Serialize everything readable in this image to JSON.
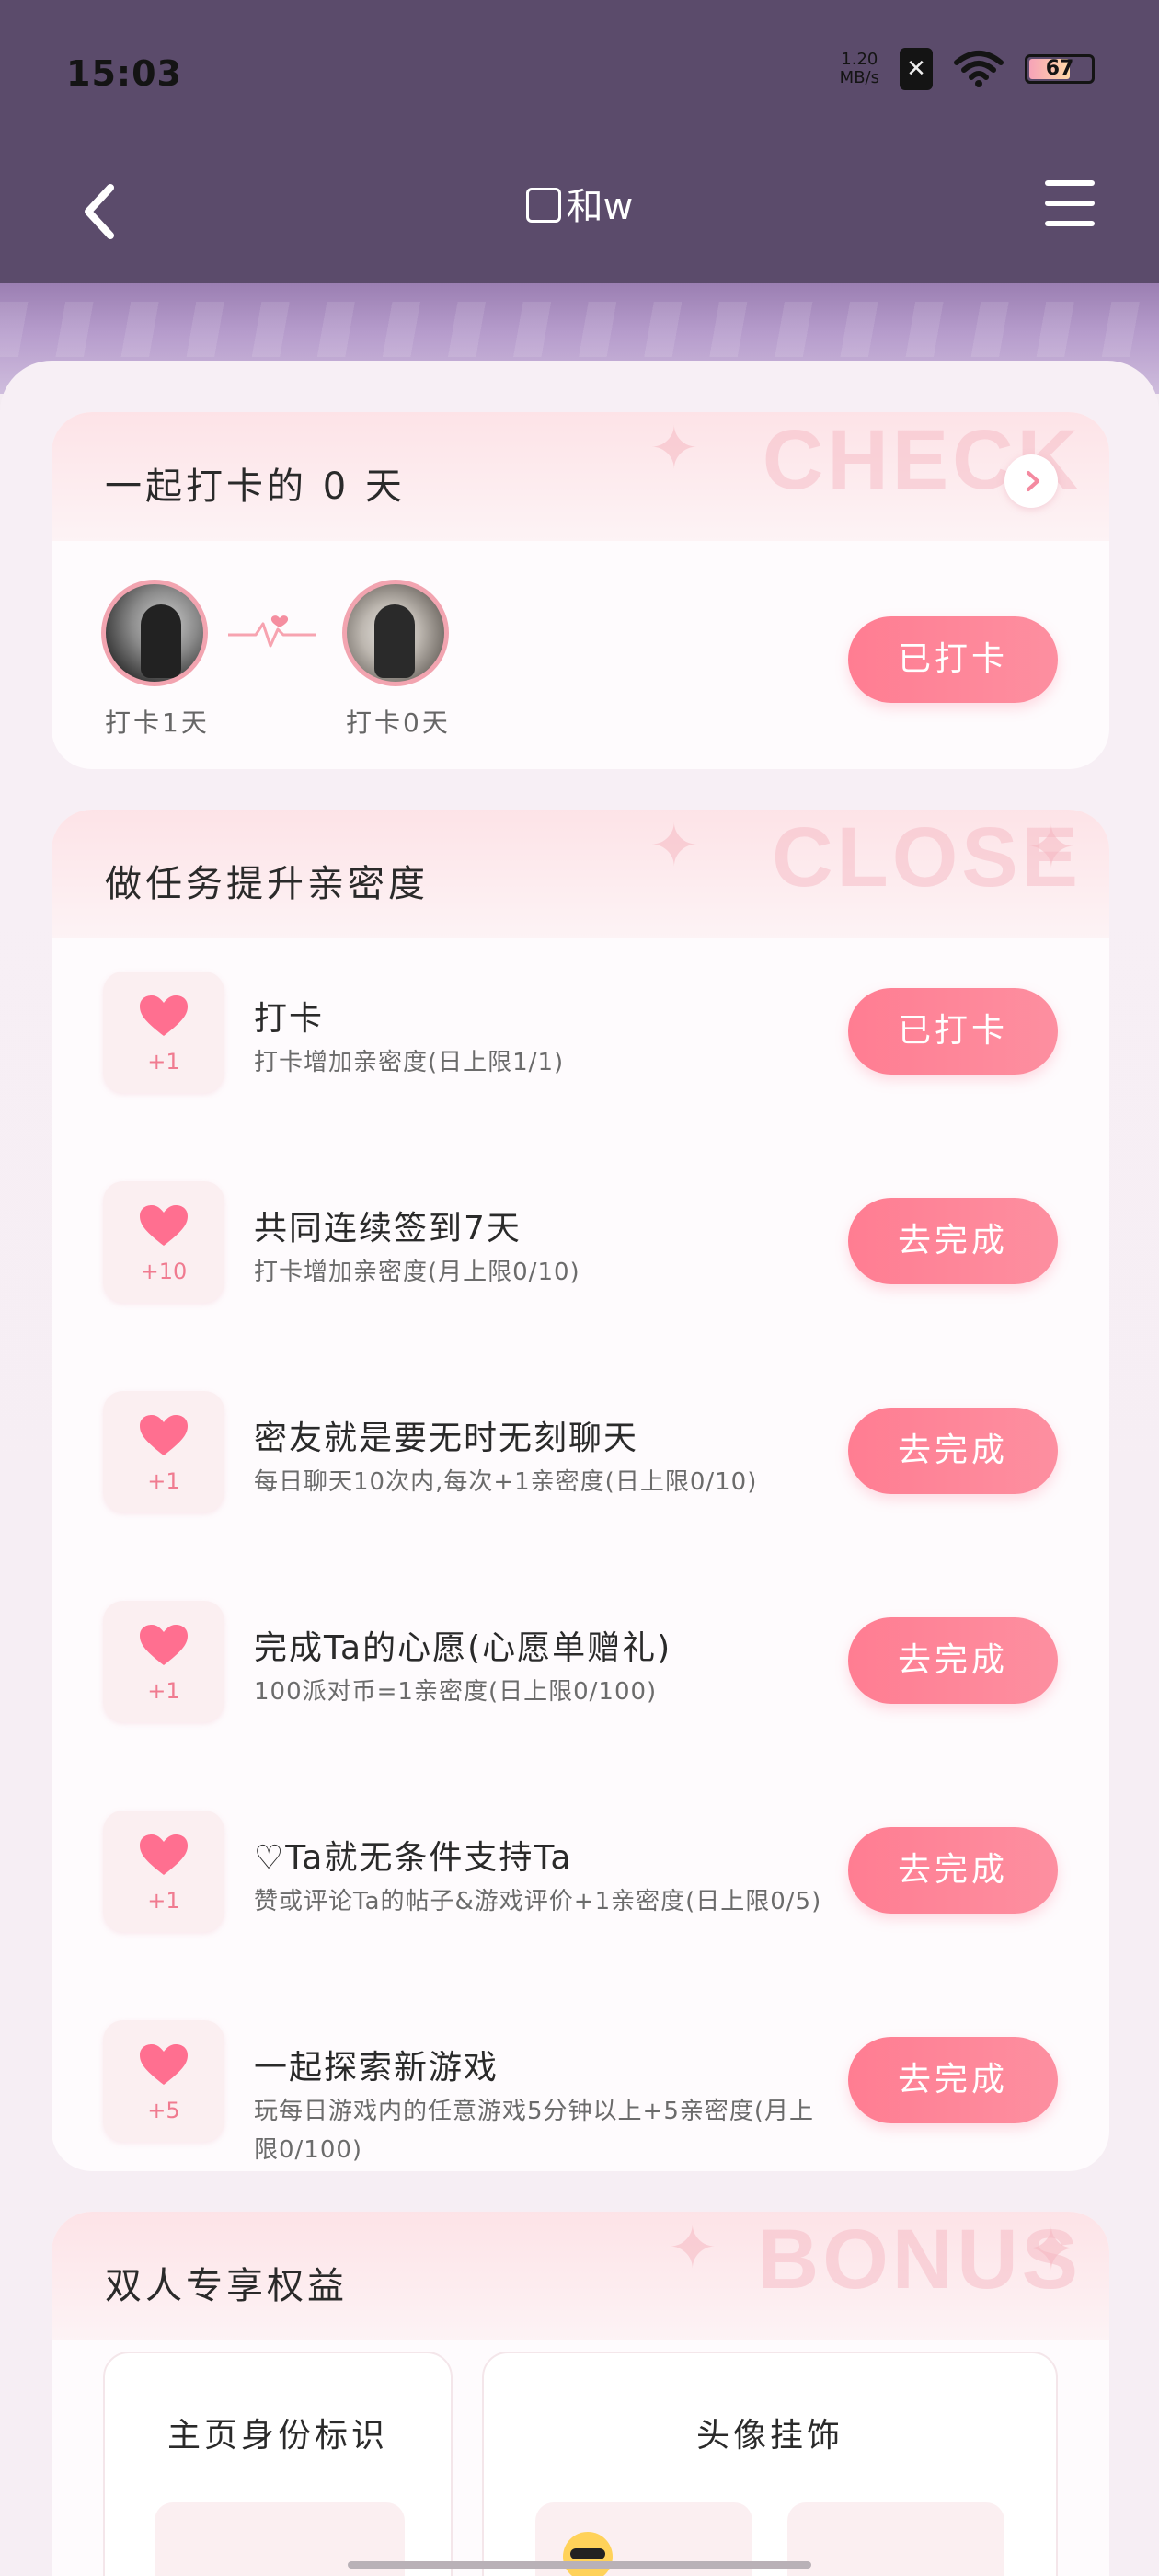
{
  "status_bar": {
    "time": "15:03",
    "net_speed_value": "1.20",
    "net_speed_unit": "MB/s",
    "sim_icon": "no-sim-icon",
    "battery_level": "67",
    "battery_percent": 67
  },
  "header": {
    "title": "和w",
    "back_icon": "chevron-left-icon",
    "menu_icon": "hamburger-menu-icon"
  },
  "checkin": {
    "title": "一起打卡的 0 天",
    "watermark": "CHECK",
    "user1_label": "打卡1天",
    "user2_label": "打卡0天",
    "button": "已打卡"
  },
  "tasks": {
    "title": "做任务提升亲密度",
    "watermark": "CLOSE",
    "items": [
      {
        "name": "打卡",
        "desc": "打卡增加亲密度(日上限1/1)",
        "points": "+1",
        "button": "已打卡"
      },
      {
        "name": "共同连续签到7天",
        "desc": "打卡增加亲密度(月上限0/10)",
        "points": "+10",
        "button": "去完成"
      },
      {
        "name": "密友就是要无时无刻聊天",
        "desc": "每日聊天10次内,每次+1亲密度(日上限0/10)",
        "points": "+1",
        "button": "去完成"
      },
      {
        "name": "完成Ta的心愿(心愿单赠礼)",
        "desc": "100派对币=1亲密度(日上限0/100)",
        "points": "+1",
        "button": "去完成"
      },
      {
        "name": "♡Ta就无条件支持Ta",
        "desc": "赞或评论Ta的帖子&游戏评价+1亲密度(日上限0/5)",
        "points": "+1",
        "button": "去完成"
      },
      {
        "name": "一起探索新游戏",
        "desc": "玩每日游戏内的任意游戏5分钟以上+5亲密度(月上限0/100)",
        "points": "+5",
        "button": "去完成"
      }
    ]
  },
  "bonus": {
    "title": "双人专享权益",
    "watermark": "BONUS",
    "perk1": "主页身份标识",
    "perk2": "头像挂饰"
  },
  "colors": {
    "accent": "#ff7d92",
    "header_bg": "#5b4b6b",
    "sheet_bg": "#f7eff5"
  }
}
